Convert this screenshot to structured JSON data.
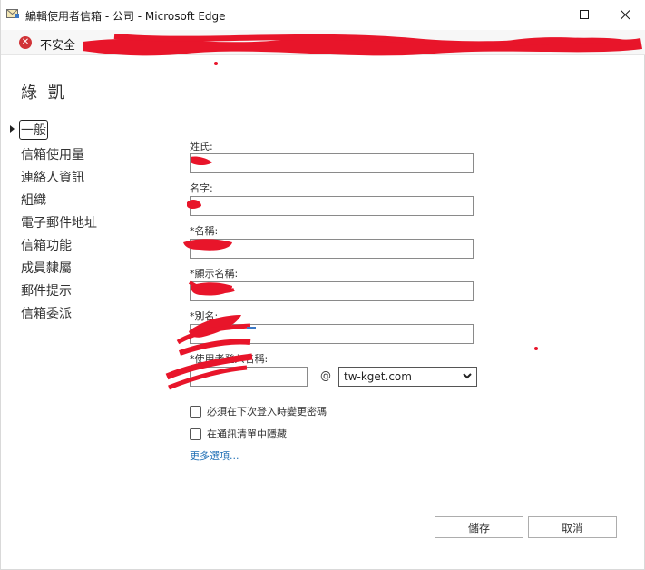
{
  "window": {
    "title": "編輯使用者信箱 - 公司 - Microsoft Edge",
    "minimize": "—",
    "maximize": "☐",
    "close": "✕"
  },
  "address_bar": {
    "security_label": "不安全",
    "security_icon": "✕"
  },
  "page": {
    "title": "綠 凱"
  },
  "nav": {
    "items": [
      {
        "label": "一般"
      },
      {
        "label": "信箱使用量"
      },
      {
        "label": "連絡人資訊"
      },
      {
        "label": "組織"
      },
      {
        "label": "電子郵件地址"
      },
      {
        "label": "信箱功能"
      },
      {
        "label": "成員隸屬"
      },
      {
        "label": "郵件提示"
      },
      {
        "label": "信箱委派"
      }
    ]
  },
  "form": {
    "last_name_label": "姓氏:",
    "first_name_label": "名字:",
    "name_label": "*名稱:",
    "display_name_label": "*顯示名稱:",
    "alias_label": "*別名:",
    "logon_name_label": "*使用者登入名稱:",
    "at_sign": "@",
    "domain_value": "tw-kget.com",
    "require_password_change_label": "必須在下次登入時變更密碼",
    "hide_from_address_list_label": "在通訊清單中隱藏",
    "more_options_label": "更多選項..."
  },
  "buttons": {
    "save": "儲存",
    "cancel": "取消"
  },
  "colors": {
    "accent_link": "#1f6fb5",
    "security_red": "#d13438",
    "redaction_red": "#e8152a"
  }
}
